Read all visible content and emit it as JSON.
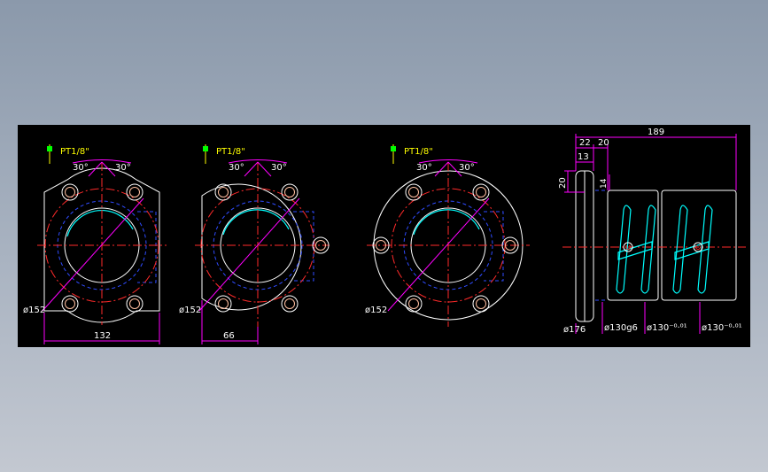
{
  "colors": {
    "background": "#000000",
    "outline": "#ffffff",
    "centerline": "#ff2a2a",
    "hidden": "#2f4bff",
    "dimension": "#ff00ff",
    "text": "#ffffff",
    "section": "#00ffff",
    "leader": "#ffff00",
    "marker": "#00ff00"
  },
  "view_left": {
    "thread_label": "PT1/8\"",
    "angle_left": "30°",
    "angle_right": "30°",
    "diameter_label": "ø152",
    "width_dim": "132"
  },
  "view_middle": {
    "thread_label": "PT1/8\"",
    "angle_left": "30°",
    "angle_right": "30°",
    "diameter_label": "ø152",
    "half_dim": "66"
  },
  "view_right": {
    "thread_label": "PT1/8\"",
    "angle_left": "30°",
    "angle_right": "30°",
    "diameter_label": "ø152"
  },
  "side_view": {
    "overall_length": "189",
    "flange_dim_a": "22",
    "flange_dim_b": "20",
    "flange_dim_c": "13",
    "height_dim": "20",
    "offset_dim": "14",
    "flange_diameter": "ø176",
    "body_diameter_1": "ø130g6",
    "body_diameter_2": "ø130⁻⁰·⁰¹",
    "body_diameter_3": "ø130⁻⁰·⁰¹"
  }
}
